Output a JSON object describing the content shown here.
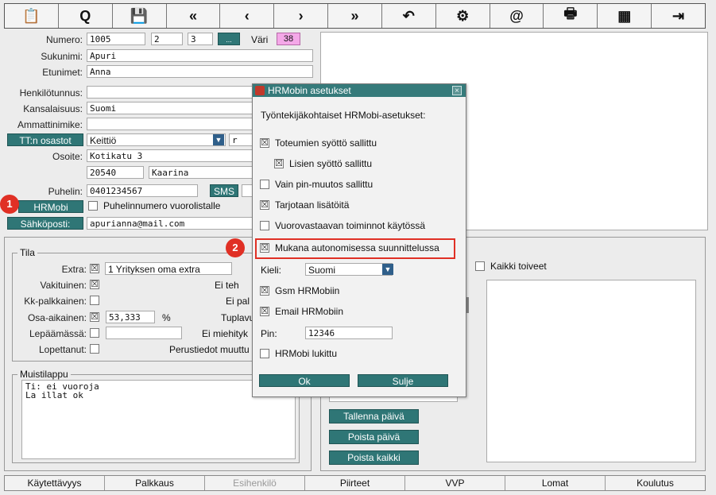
{
  "toolbar": {
    "buttons": [
      {
        "name": "clipboard-icon",
        "glyph": "📋"
      },
      {
        "name": "search-icon",
        "glyph": "Q"
      },
      {
        "name": "save-icon",
        "glyph": "💾"
      },
      {
        "name": "first-record-icon",
        "glyph": "«"
      },
      {
        "name": "previous-record-icon",
        "glyph": "‹"
      },
      {
        "name": "next-record-icon",
        "glyph": "›"
      },
      {
        "name": "last-record-icon",
        "glyph": "»"
      },
      {
        "name": "undo-icon",
        "glyph": "↶"
      },
      {
        "name": "settings-gears-icon",
        "glyph": "⚙"
      },
      {
        "name": "email-icon",
        "glyph": "@"
      },
      {
        "name": "print-icon",
        "glyph": "🖶"
      },
      {
        "name": "calendar-icon",
        "glyph": "▦"
      },
      {
        "name": "exit-icon",
        "glyph": "⇥"
      }
    ]
  },
  "form": {
    "numero_label": "Numero:",
    "numero": "1005",
    "numero2": "2",
    "numero3": "3",
    "dots_button": "...",
    "vari_label": "Väri",
    "vari_value": "38",
    "sukunimi_label": "Sukunimi:",
    "sukunimi": "Apuri",
    "etunimet_label": "Etunimet:",
    "etunimet": "Anna",
    "henkilotunnus_label": "Henkilötunnus:",
    "henkilotunnus": "",
    "kansalaisuus_label": "Kansalaisuus:",
    "kansalaisuus": "Suomi",
    "ammattinimike_label": "Ammattinimike:",
    "ammattinimike": "",
    "tt_osastot_button": "TT:n osastot",
    "osasto": "Keittiö",
    "osasto_extra": "r",
    "osoite_label": "Osoite:",
    "osoite": "Kotikatu 3",
    "postinumero": "20540",
    "kaupunki": "Kaarina",
    "puhelin_label": "Puhelin:",
    "puhelin": "0401234567",
    "sms_button": "SMS",
    "hrmobi_button": "HRMobi",
    "puhelinnumero_checkbox": "Puhelinnumero vuorolistalle",
    "sahkoposti_button": "Sähköposti:",
    "sahkoposti": "apurianna@mail.com"
  },
  "tila": {
    "title": "Tila",
    "extra_label": "Extra:",
    "extra_checked": "☒",
    "extra_value": "1 Yrityksen oma extra",
    "vakituinen_label": "Vakituinen:",
    "kk_label": "Kk-palkkainen:",
    "osa_aikainen_label": "Osa-aikainen:",
    "osa_aikainen_value": "53,333",
    "percent": "%",
    "lepaamassa_label": "Lepäämässä:",
    "lopettanut_label": "Lopettanut:",
    "ei_teh_label": "Ei teh",
    "ei_pal_label": "Ei pal",
    "tuplav_label": "Tuplavu",
    "ei_miehityk_label": "Ei miehityk",
    "perustiedot_label": "Perustiedot muuttu"
  },
  "muistilappu": {
    "title": "Muistilappu",
    "text": "Ti: ei vuoroja\nLa illat ok"
  },
  "right_panel": {
    "kaikki_toiveet": "Kaikki toiveet",
    "tallenna_paiva": "Tallenna päivä",
    "poista_paiva": "Poista päivä",
    "poista_kaikki": "Poista kaikki"
  },
  "dialog": {
    "title": "HRMobin asetukset",
    "heading": "Työntekijäkohtaiset HRMobi-asetukset:",
    "opt_toteumat": "Toteumien syöttö sallittu",
    "opt_lisat": "Lisien syöttö sallittu",
    "opt_pin": "Vain pin-muutos sallittu",
    "opt_tarjotaan": "Tarjotaan lisätöitä",
    "opt_vuorovastaava": "Vuorovastaavan toiminnot käytössä",
    "opt_autonominen": "Mukana autonomisessa suunnittelussa",
    "kieli_label": "Kieli:",
    "kieli_value": "Suomi",
    "opt_gsm": "Gsm HRMobiin",
    "opt_email": "Email HRMobiin",
    "pin_label": "Pin:",
    "pin_value": "12346",
    "opt_lukittu": "HRMobi lukittu",
    "ok_button": "Ok",
    "sulje_button": "Sulje",
    "checked_glyph": "☒"
  },
  "annotations": {
    "badge1": "1",
    "badge2": "2",
    "highlight_color": "#e03025"
  },
  "tabs": [
    "Käytettävyys",
    "Palkkaus",
    "Esihenkilö",
    "Piirteet",
    "VVP",
    "Lomat",
    "Koulutus"
  ]
}
